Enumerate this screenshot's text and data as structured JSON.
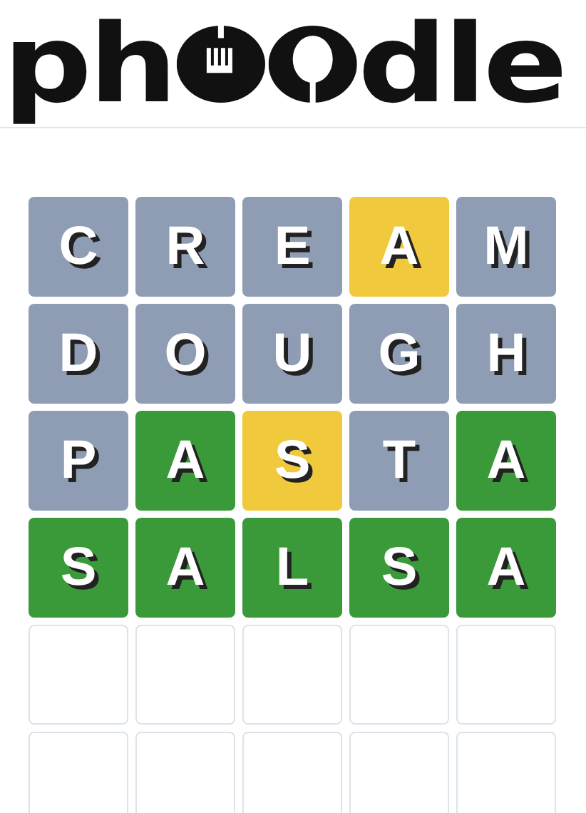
{
  "logo": {
    "start": "ph",
    "end": "dle"
  },
  "board": {
    "rows": [
      {
        "tiles": [
          {
            "letter": "C",
            "kind": "absent"
          },
          {
            "letter": "R",
            "kind": "absent"
          },
          {
            "letter": "E",
            "kind": "absent"
          },
          {
            "letter": "A",
            "kind": "present"
          },
          {
            "letter": "M",
            "kind": "absent"
          }
        ]
      },
      {
        "tiles": [
          {
            "letter": "D",
            "kind": "absent"
          },
          {
            "letter": "O",
            "kind": "absent"
          },
          {
            "letter": "U",
            "kind": "absent"
          },
          {
            "letter": "G",
            "kind": "absent"
          },
          {
            "letter": "H",
            "kind": "absent"
          }
        ]
      },
      {
        "tiles": [
          {
            "letter": "P",
            "kind": "absent"
          },
          {
            "letter": "A",
            "kind": "correct"
          },
          {
            "letter": "S",
            "kind": "present"
          },
          {
            "letter": "T",
            "kind": "absent"
          },
          {
            "letter": "A",
            "kind": "correct"
          }
        ]
      },
      {
        "tiles": [
          {
            "letter": "S",
            "kind": "correct"
          },
          {
            "letter": "A",
            "kind": "correct"
          },
          {
            "letter": "L",
            "kind": "correct"
          },
          {
            "letter": "S",
            "kind": "correct"
          },
          {
            "letter": "A",
            "kind": "correct"
          }
        ]
      },
      {
        "tiles": [
          {
            "kind": "empty"
          },
          {
            "kind": "empty"
          },
          {
            "kind": "empty"
          },
          {
            "kind": "empty"
          },
          {
            "kind": "empty"
          }
        ]
      },
      {
        "tiles": [
          {
            "kind": "empty"
          },
          {
            "kind": "empty"
          },
          {
            "kind": "empty"
          },
          {
            "kind": "empty"
          },
          {
            "kind": "empty"
          }
        ]
      }
    ]
  }
}
